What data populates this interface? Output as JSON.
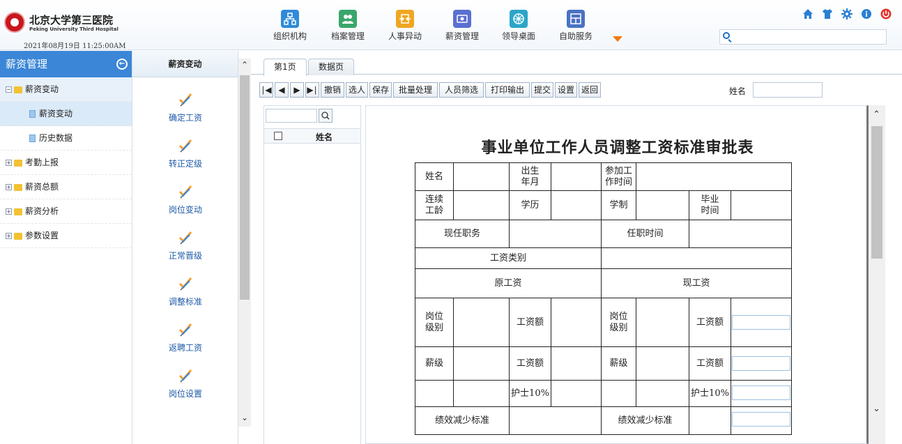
{
  "header": {
    "hospital_name": "北京大学第三医院",
    "hospital_name_en": "Peking University Third Hospital",
    "datetime": "2021年08月19日 11:25:00AM",
    "nav": [
      {
        "label": "组织机构",
        "icon": "org-chart-icon",
        "color": "#2f8ad8"
      },
      {
        "label": "档案管理",
        "icon": "people-icon",
        "color": "#3aa66b"
      },
      {
        "label": "人事异动",
        "icon": "transfer-icon",
        "color": "#f0a620"
      },
      {
        "label": "薪资管理",
        "icon": "money-icon",
        "color": "#5b6fd1"
      },
      {
        "label": "领导桌面",
        "icon": "dashboard-icon",
        "color": "#2ba6c9"
      },
      {
        "label": "自助服务",
        "icon": "grid-icon",
        "color": "#4a71c3"
      }
    ],
    "more_icon": "triangle-down-icon",
    "top_icons": [
      {
        "name": "home-icon",
        "color": "#2a7fd2"
      },
      {
        "name": "shirt-icon",
        "color": "#2a7fd2"
      },
      {
        "name": "gear-icon",
        "color": "#2a7fd2"
      },
      {
        "name": "info-icon",
        "color": "#2a7fd2"
      },
      {
        "name": "power-icon",
        "color": "#e5322d"
      }
    ],
    "search_value": ""
  },
  "sidebar": {
    "title": "薪资管理",
    "items": [
      {
        "label": "薪资变动",
        "level": 1,
        "expanded": true
      },
      {
        "label": "薪资变动",
        "level": 2
      },
      {
        "label": "历史数据",
        "level": 2
      },
      {
        "label": "考勤上报",
        "level": 1,
        "expanded": false
      },
      {
        "label": "薪资总额",
        "level": 1,
        "expanded": false
      },
      {
        "label": "薪资分析",
        "level": 1,
        "expanded": false
      },
      {
        "label": "参数设置",
        "level": 1,
        "expanded": false
      }
    ]
  },
  "funcs": {
    "title": "薪资变动",
    "items": [
      "确定工资",
      "转正定级",
      "岗位变动",
      "正常晋级",
      "调整标准",
      "返聘工资",
      "岗位设置"
    ]
  },
  "main": {
    "tabs": [
      "第1页",
      "数据页"
    ],
    "toolbar": [
      "撤销",
      "选人",
      "保存",
      "批量处理",
      "人员筛选",
      "打印输出",
      "提交",
      "设置",
      "返回"
    ],
    "name_label": "姓名",
    "name_value": "",
    "list_header": "姓名"
  },
  "form": {
    "title": "事业单位工作人员调整工资标准审批表",
    "labels": {
      "name": "姓名",
      "birth": "出生\n年月",
      "work_start": "参加工\n作时间",
      "seniority": "连续\n工龄",
      "education": "学历",
      "school_years": "学制",
      "graduation": "毕业\n时间",
      "position": "现任职务",
      "tenure": "任职时间",
      "wage_type": "工资类别",
      "old_wage": "原工资",
      "new_wage": "现工资",
      "post_level": "岗位\n级别",
      "wage_amount": "工资额",
      "pay_grade": "薪级",
      "nurse": "护士10%",
      "perf_reduction": "绩效减少标准"
    }
  },
  "colors": {
    "accent": "#3b86d6",
    "func_text": "#1e5aa8"
  }
}
